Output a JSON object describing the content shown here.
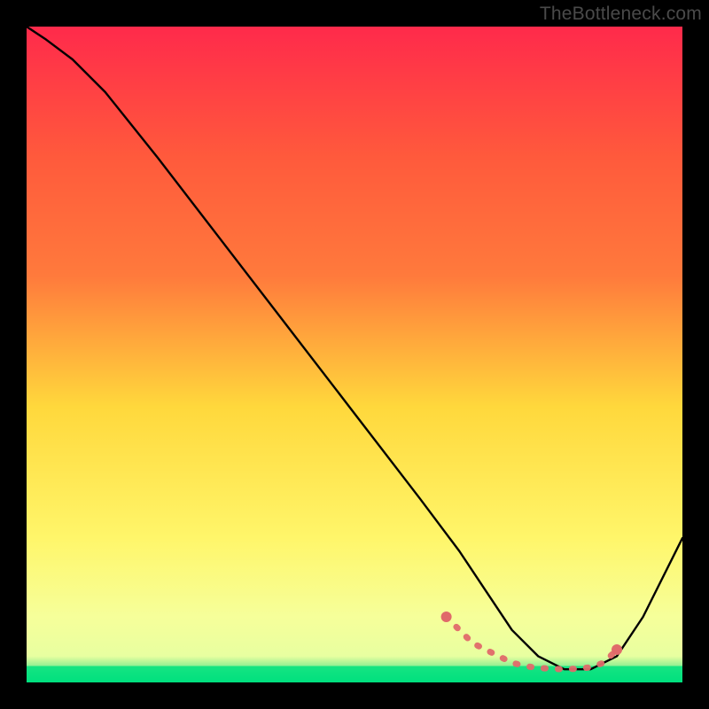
{
  "watermark": "TheBottleneck.com",
  "chart_data": {
    "type": "line",
    "title": "",
    "xlabel": "",
    "ylabel": "",
    "xlim": [
      0,
      100
    ],
    "ylim": [
      0,
      100
    ],
    "grid": false,
    "legend": false,
    "gradient": {
      "top": "#ff2a4b",
      "mid_high": "#ff7a3c",
      "mid": "#ffd83c",
      "mid_low": "#fff66a",
      "low": "#e8ffa0",
      "bottom": "#00d47a"
    },
    "series": [
      {
        "name": "bottleneck-curve",
        "color": "#000000",
        "x": [
          0,
          3,
          7,
          12,
          20,
          30,
          40,
          50,
          60,
          66,
          70,
          74,
          78,
          82,
          86,
          90,
          94,
          100
        ],
        "y": [
          100,
          98,
          95,
          90,
          80,
          67,
          54,
          41,
          28,
          20,
          14,
          8,
          4,
          2,
          2,
          4,
          10,
          22
        ]
      },
      {
        "name": "optimal-range-markers",
        "color": "#e06a6a",
        "style": "points-dashed",
        "x": [
          64,
          68,
          72,
          74,
          76,
          78,
          80,
          82,
          84,
          86,
          88,
          90
        ],
        "y": [
          10,
          6,
          4,
          3,
          2.5,
          2.2,
          2.1,
          2,
          2.1,
          2.3,
          3,
          5
        ]
      }
    ],
    "green_band": {
      "y_top": 2.5,
      "y_bottom": 0,
      "color": "#00e27f"
    }
  }
}
